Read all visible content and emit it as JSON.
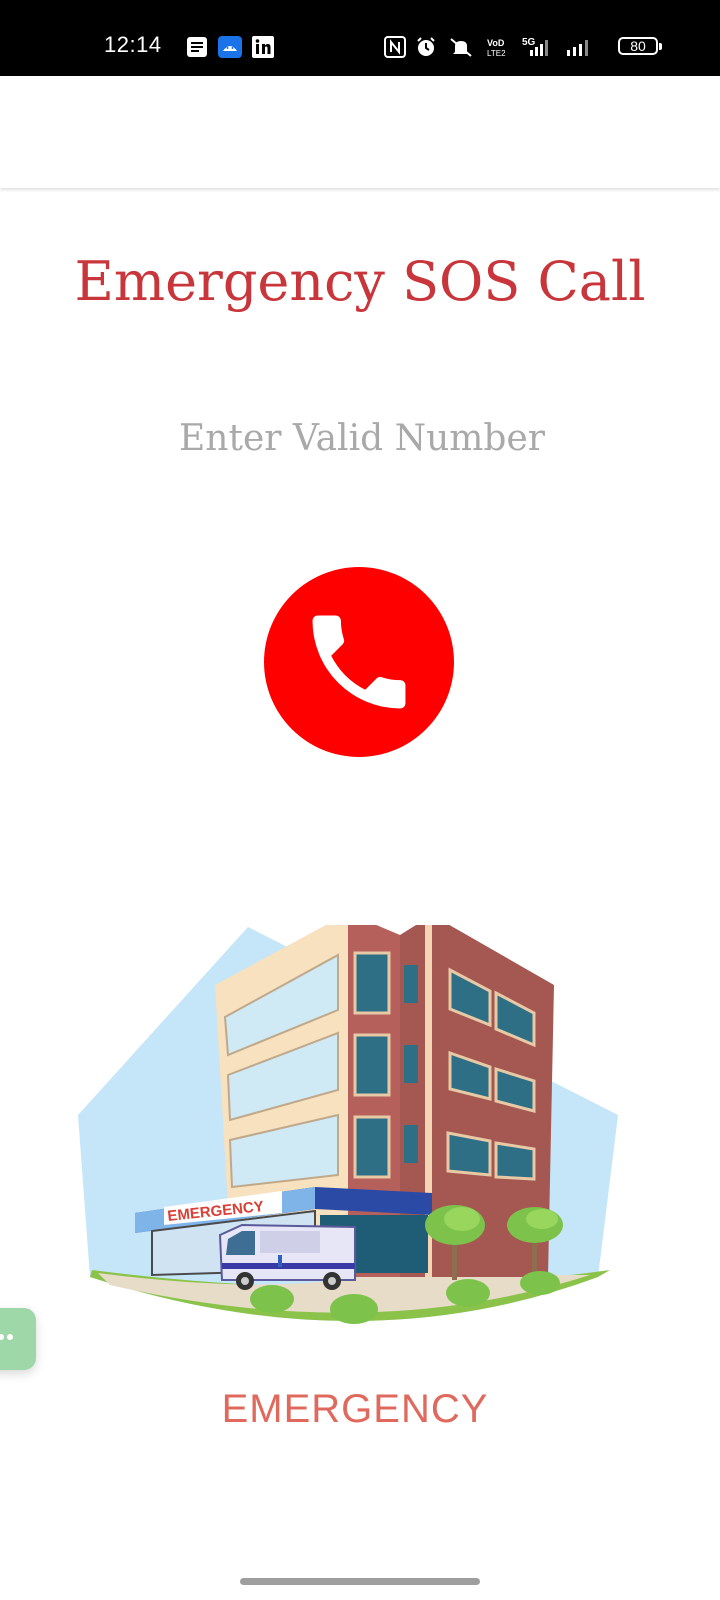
{
  "status_bar": {
    "time": "12:14",
    "battery": "80",
    "network": "5G",
    "icons": [
      "news-icon",
      "android-icon",
      "linkedin-icon",
      "nfc-icon",
      "alarm-icon",
      "mute-icon",
      "volte-icon",
      "signal-icon"
    ]
  },
  "page": {
    "title": "Emergency SOS Call",
    "number_placeholder": "Enter Valid Number",
    "caption": "EMERGENCY",
    "illustration_sign": "EMERGENCY"
  },
  "colors": {
    "title": "#c8353a",
    "call_button": "#ff0000",
    "caption": "#e0695e",
    "fab": "#9fd8a8"
  }
}
